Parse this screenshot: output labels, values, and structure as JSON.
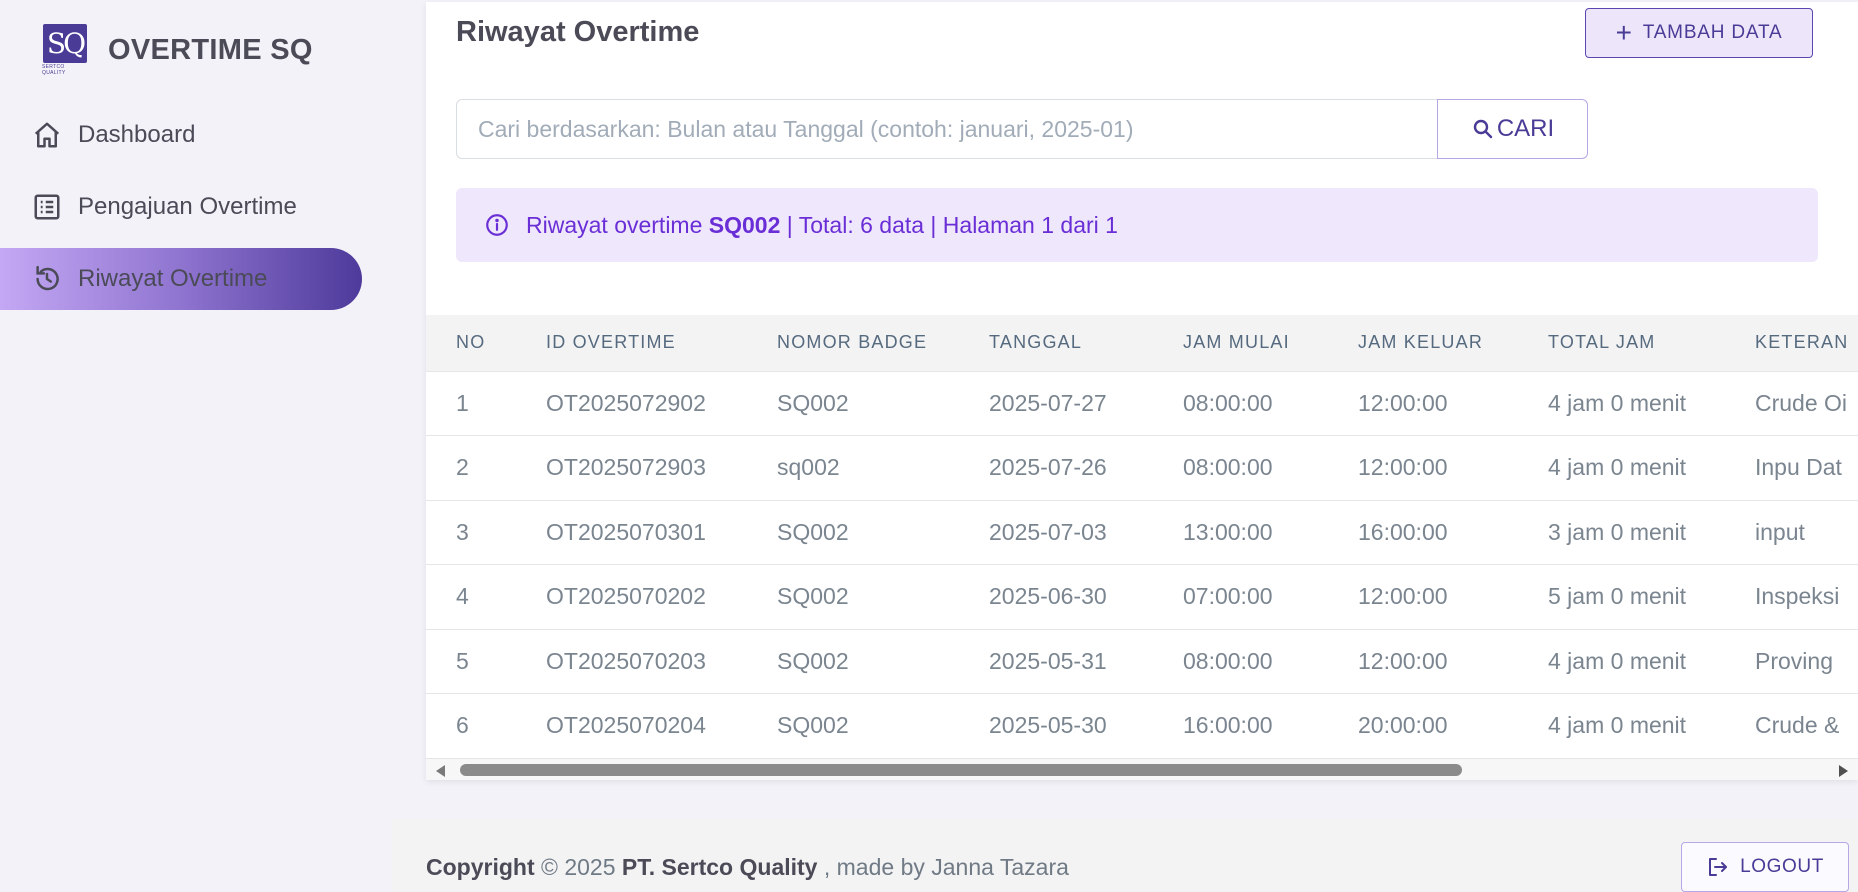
{
  "brand": {
    "logo_text": "SQ",
    "logo_subtext": "SERTCO QUALITY",
    "name": "OVERTIME SQ"
  },
  "sidebar": {
    "items": [
      {
        "label": "Dashboard",
        "icon": "home-icon"
      },
      {
        "label": "Pengajuan Overtime",
        "icon": "list-icon"
      },
      {
        "label": "Riwayat Overtime",
        "icon": "history-icon",
        "active": true
      }
    ]
  },
  "main": {
    "title": "Riwayat Overtime",
    "add_button": "TAMBAH DATA",
    "search": {
      "placeholder": "Cari berdasarkan: Bulan atau Tanggal (contoh: januari, 2025-01)",
      "value": "",
      "button": "CARI"
    },
    "alert": {
      "prefix": "Riwayat overtime ",
      "badge": "SQ002",
      "suffix": " | Total: 6 data | Halaman 1 dari 1"
    }
  },
  "table": {
    "columns": [
      "NO",
      "ID OVERTIME",
      "NOMOR BADGE",
      "TANGGAL",
      "JAM MULAI",
      "JAM KELUAR",
      "TOTAL JAM",
      "KETERAN"
    ],
    "rows": [
      [
        "1",
        "OT2025072902",
        "SQ002",
        "2025-07-27",
        "08:00:00",
        "12:00:00",
        "4 jam 0 menit",
        "Crude Oi"
      ],
      [
        "2",
        "OT2025072903",
        "sq002",
        "2025-07-26",
        "08:00:00",
        "12:00:00",
        "4 jam 0 menit",
        "Inpu Dat"
      ],
      [
        "3",
        "OT2025070301",
        "SQ002",
        "2025-07-03",
        "13:00:00",
        "16:00:00",
        "3 jam 0 menit",
        "input"
      ],
      [
        "4",
        "OT2025070202",
        "SQ002",
        "2025-06-30",
        "07:00:00",
        "12:00:00",
        "5 jam 0 menit",
        "Inspeksi"
      ],
      [
        "5",
        "OT2025070203",
        "SQ002",
        "2025-05-31",
        "08:00:00",
        "12:00:00",
        "4 jam 0 menit",
        "Proving"
      ],
      [
        "6",
        "OT2025070204",
        "SQ002",
        "2025-05-30",
        "16:00:00",
        "20:00:00",
        "4 jam 0 menit",
        "Crude &"
      ]
    ]
  },
  "footer": {
    "copyright_word": "Copyright",
    "year_text": "© 2025",
    "company": "PT. Sertco Quality",
    "made_by": ", made by Janna Tazara",
    "logout": "LOGOUT"
  },
  "colors": {
    "accent": "#4a3b96",
    "alert_bg": "#efe7fc",
    "alert_text": "#6a2ed6"
  }
}
